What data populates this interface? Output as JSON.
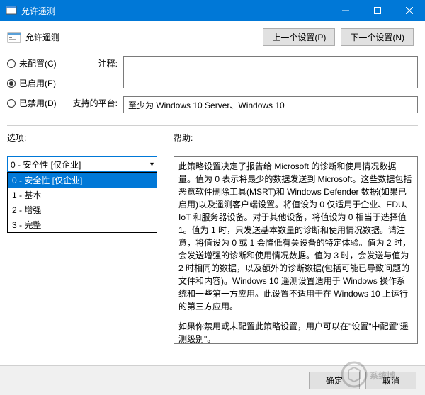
{
  "window": {
    "title": "允许遥测"
  },
  "header": {
    "title": "允许遥测",
    "prev_btn": "上一个设置(P)",
    "next_btn": "下一个设置(N)"
  },
  "radios": {
    "not_configured": "未配置(C)",
    "enabled": "已启用(E)",
    "disabled": "已禁用(D)",
    "selected": "enabled"
  },
  "labels": {
    "notes": "注释:",
    "platforms": "支持的平台:",
    "options": "选项:",
    "help": "帮助:"
  },
  "platform_text": "至少为 Windows 10 Server、Windows 10",
  "combo": {
    "value": "0 - 安全性 [仅企业]",
    "options": [
      "0 - 安全性 [仅企业]",
      "1 - 基本",
      "2 - 增强",
      "3 - 完整"
    ]
  },
  "help_text": {
    "p1": "此策略设置决定了报告给 Microsoft 的诊断和使用情况数据量。值为 0 表示将最少的数据发送到 Microsoft。这些数据包括恶意软件删除工具(MSRT)和 Windows Defender 数据(如果已启用)以及遥测客户端设置。将值设为 0 仅适用于企业、EDU、IoT 和服务器设备。对于其他设备，将值设为 0 相当于选择值 1。值为 1 时，只发送基本数量的诊断和使用情况数据。请注意，将值设为 0 或 1 会降低有关设备的特定体验。值为 2 时，会发送增强的诊断和使用情况数据。值为 3 时，会发送与值为 2 时相同的数据，以及额外的诊断数据(包括可能已导致问题的文件和内容)。Windows 10 遥测设置适用于 Windows 操作系统和一些第一方应用。此设置不适用于在 Windows 10 上运行的第三方应用。",
    "p2": "如果你禁用或未配置此策略设置，用户可以在\"设置\"中配置\"遥测级别\"。"
  },
  "footer": {
    "ok": "确定",
    "cancel": "取消"
  },
  "watermark": "系统城"
}
